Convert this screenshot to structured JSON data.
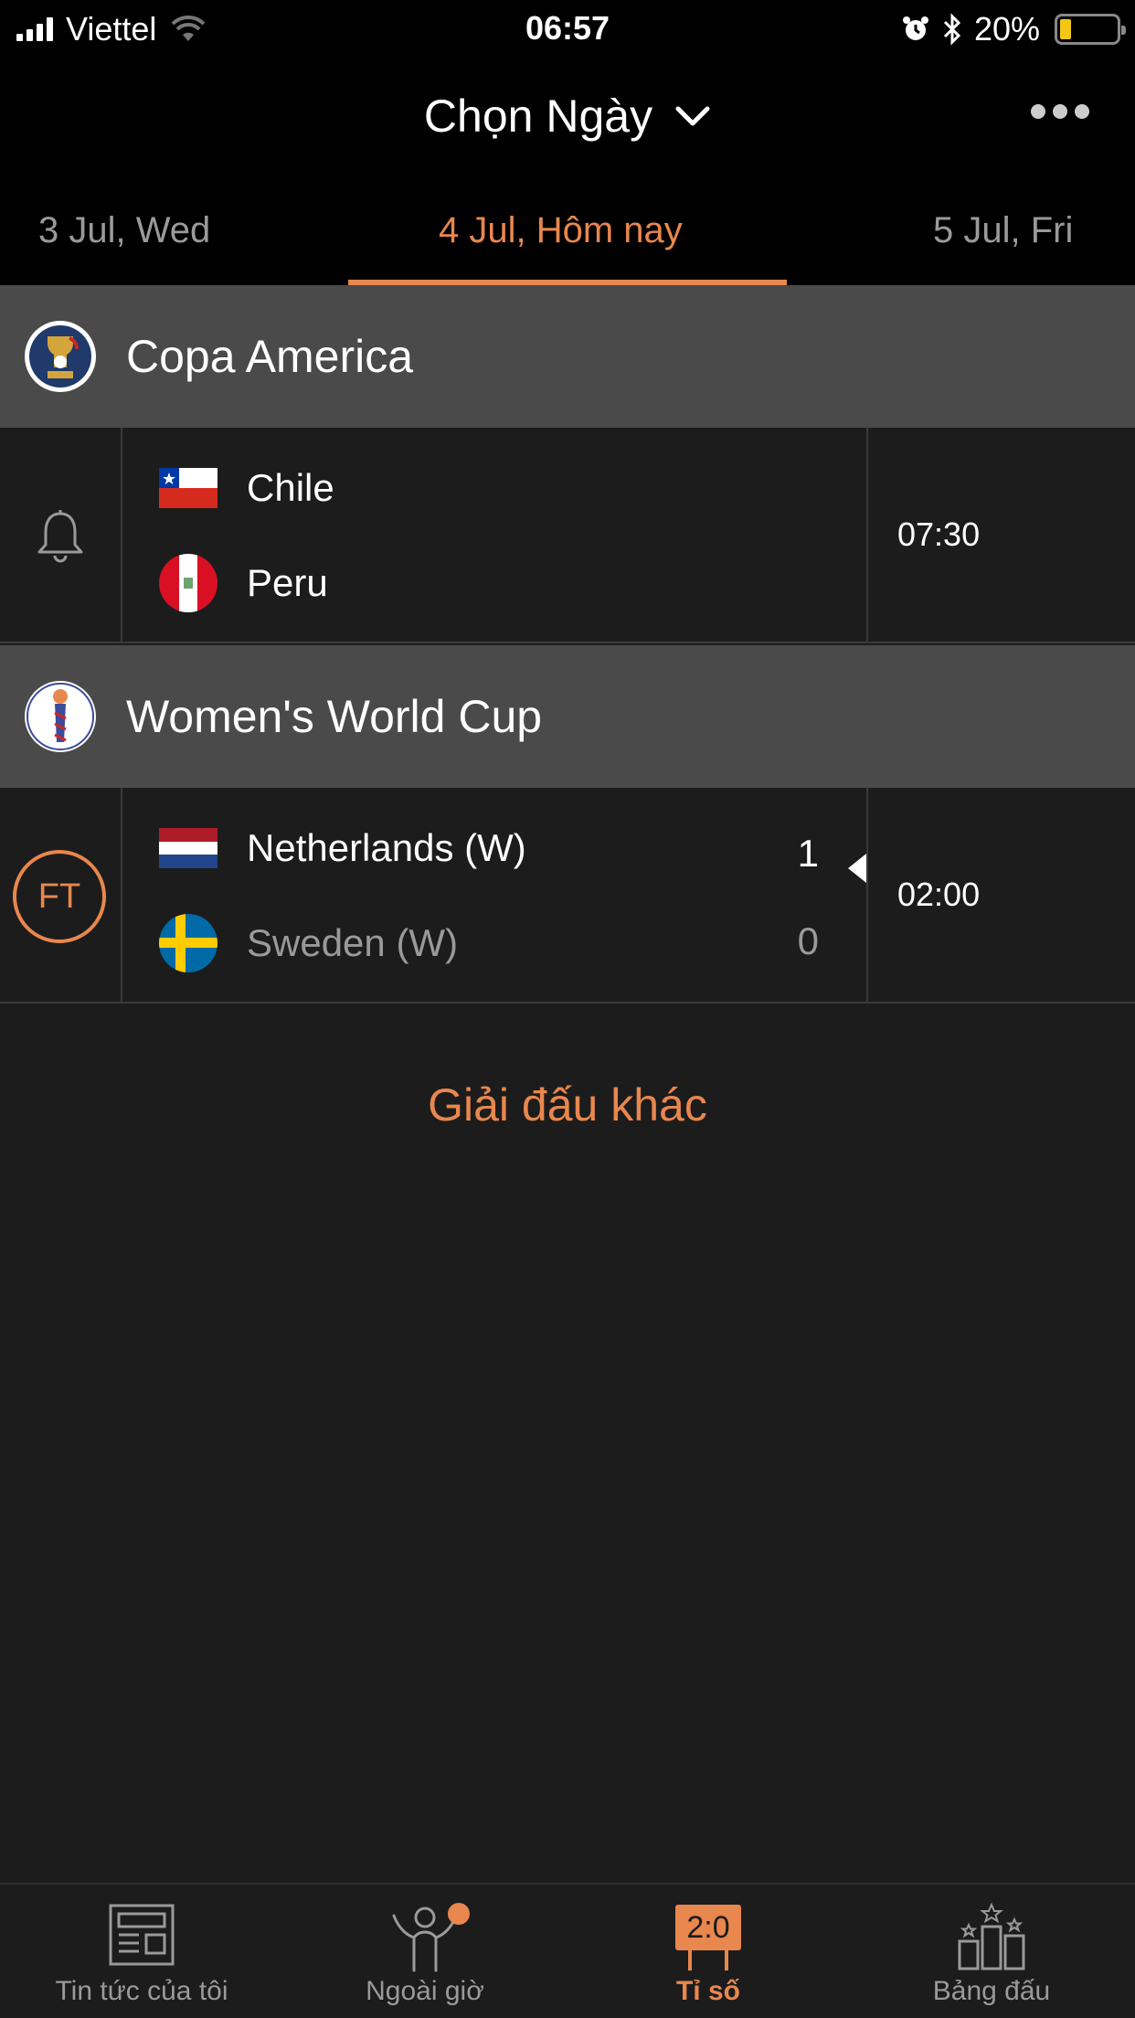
{
  "status_bar": {
    "carrier": "Viettel",
    "time": "06:57",
    "battery": "20%",
    "battery_level": 0.2
  },
  "header": {
    "title": "Chọn Ngày"
  },
  "date_tabs": [
    {
      "label": "3 Jul, Wed"
    },
    {
      "label": "4 Jul, Hôm nay"
    },
    {
      "label": "5 Jul, Fri"
    }
  ],
  "leagues": [
    {
      "name": "Copa America",
      "match": {
        "home": "Chile",
        "away": "Peru",
        "time": "07:30"
      }
    },
    {
      "name": "Women's World Cup",
      "match": {
        "status": "FT",
        "home": "Netherlands (W)",
        "away": "Sweden (W)",
        "home_score": "1",
        "away_score": "0",
        "time": "02:00"
      }
    }
  ],
  "other_leagues": "Giải đấu khác",
  "bottom_nav": [
    {
      "label": "Tin tức của tôi",
      "icon": "newspaper-icon"
    },
    {
      "label": "Ngoài giờ",
      "icon": "person-cheer-icon"
    },
    {
      "label": "Tỉ số",
      "icon": "scoreboard-icon",
      "icon_text": "2:0"
    },
    {
      "label": "Bảng đấu",
      "icon": "standings-icon"
    }
  ],
  "colors": {
    "accent": "#e8874e",
    "background": "#1c1c1c",
    "league_bar": "#4a4a4a"
  }
}
